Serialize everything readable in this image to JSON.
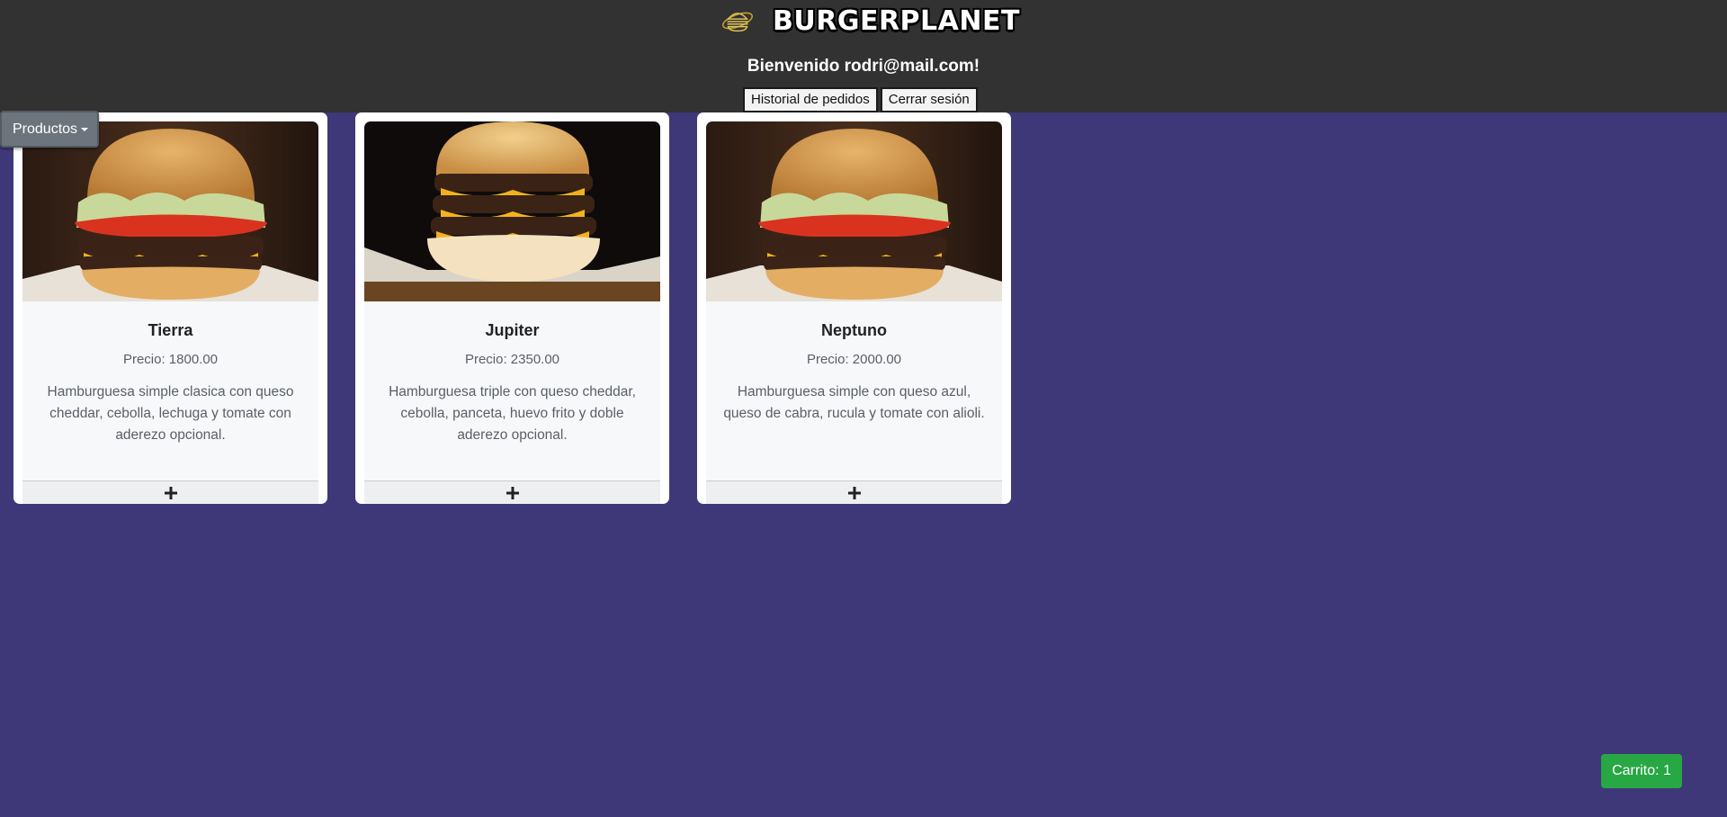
{
  "header": {
    "brand_name": "BURGERPLANET",
    "brand_icon": "burger-planet-logo-icon",
    "welcome": "Bienvenido rodri@mail.com!",
    "order_history_label": "Historial de pedidos",
    "logout_label": "Cerrar sesión"
  },
  "products_menu": {
    "label": "Productos",
    "icon": "caret-down-icon"
  },
  "products": [
    {
      "name": "Tierra",
      "price": "Precio: 1800.00",
      "description": "Hamburguesa simple clasica con queso cheddar, cebolla, lechuga y tomate con aderezo opcional.",
      "add_icon": "plus-icon"
    },
    {
      "name": "Jupiter",
      "price": "Precio: 2350.00",
      "description": "Hamburguesa triple con queso cheddar, cebolla, panceta, huevo frito y doble aderezo opcional.",
      "add_icon": "plus-icon"
    },
    {
      "name": "Neptuno",
      "price": "Precio: 2000.00",
      "description": "Hamburguesa simple con queso azul, queso de cabra, rucula y tomate con alioli.",
      "add_icon": "plus-icon"
    }
  ],
  "cart": {
    "label": "Carrito: 1"
  },
  "colors": {
    "page_background": "#3f3878",
    "header_background": "#323232",
    "cart_button": "#28a745",
    "dropdown_button": "#6c757d"
  }
}
